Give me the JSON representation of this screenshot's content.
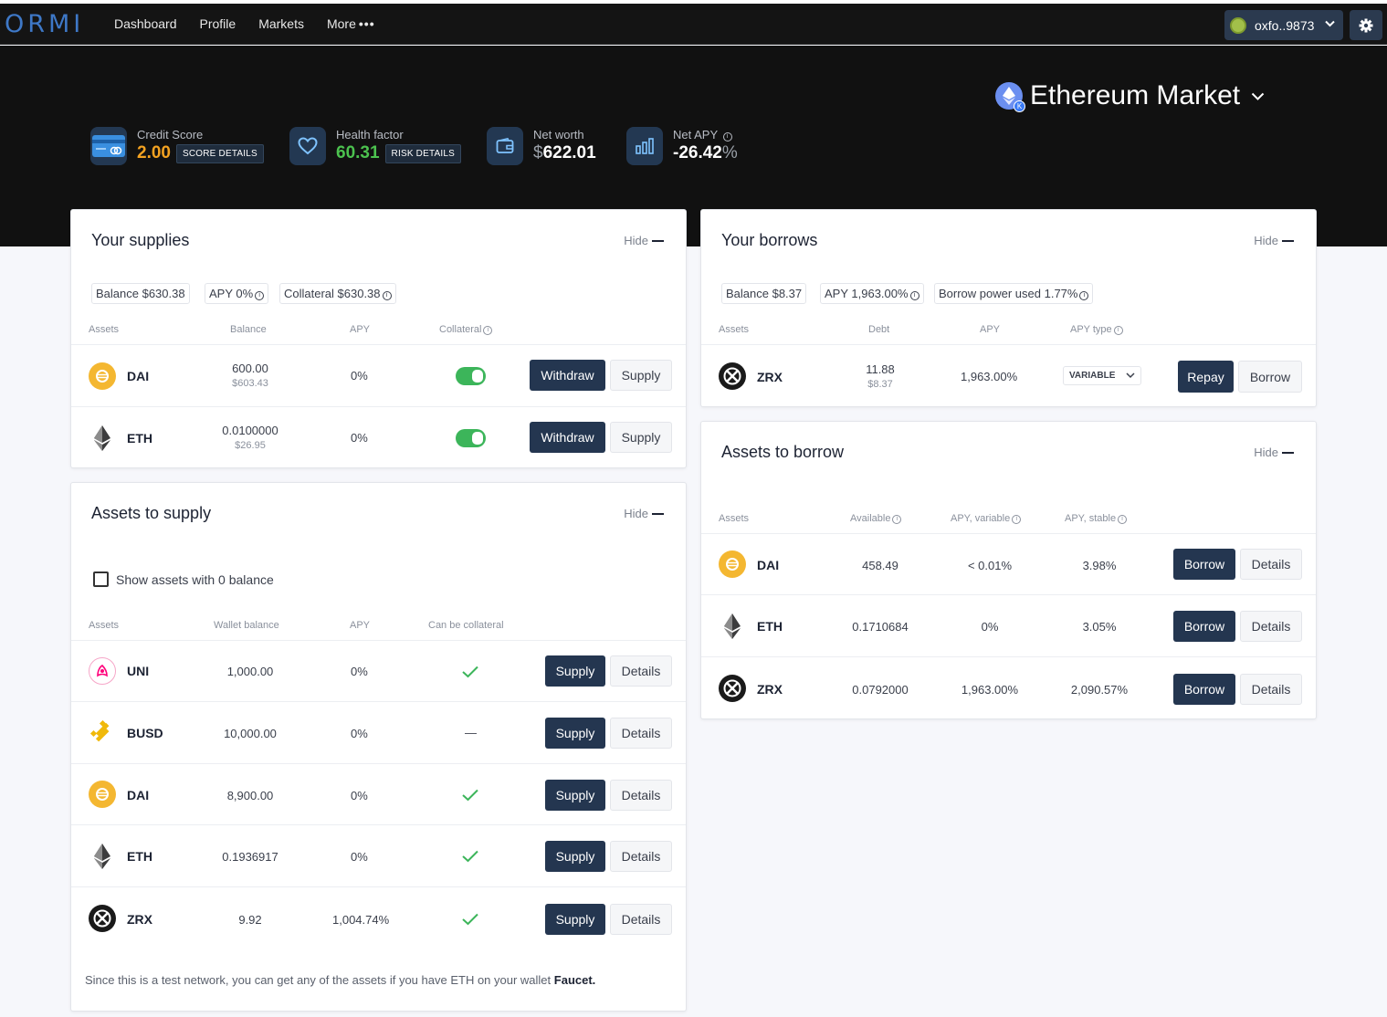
{
  "nav": {
    "logo": "ORMI",
    "links": [
      "Dashboard",
      "Profile",
      "Markets",
      "More"
    ],
    "wallet": "oxfo..9873"
  },
  "hero": {
    "market_title": "Ethereum Market",
    "credit_score": {
      "label": "Credit Score",
      "value": "2.00",
      "button": "SCORE DETAILS"
    },
    "health_factor": {
      "label": "Health factor",
      "value": "60.31",
      "button": "RISK DETAILS"
    },
    "net_worth": {
      "label": "Net worth",
      "currency": "$",
      "value": "622.01"
    },
    "net_apy": {
      "label": "Net APY",
      "value": "-26.42",
      "unit": "%"
    }
  },
  "supplies": {
    "title": "Your supplies",
    "hide": "Hide",
    "chips": {
      "balance": "Balance $630.38",
      "apy": "APY 0%",
      "collateral": "Collateral $630.38"
    },
    "headers": {
      "assets": "Assets",
      "balance": "Balance",
      "apy": "APY",
      "collateral": "Collateral"
    },
    "rows": [
      {
        "asset": "DAI",
        "balance": "600.00",
        "usd": "$603.43",
        "apy": "0%",
        "withdraw": "Withdraw",
        "supply": "Supply"
      },
      {
        "asset": "ETH",
        "balance": "0.0100000",
        "usd": "$26.95",
        "apy": "0%",
        "withdraw": "Withdraw",
        "supply": "Supply"
      }
    ]
  },
  "to_supply": {
    "title": "Assets to supply",
    "hide": "Hide",
    "show_zero": "Show assets with 0 balance",
    "headers": {
      "assets": "Assets",
      "wallet_balance": "Wallet balance",
      "apy": "APY",
      "collateral": "Can be collateral"
    },
    "rows": [
      {
        "asset": "UNI",
        "balance": "1,000.00",
        "apy": "0%",
        "collateral": "check",
        "supply": "Supply",
        "details": "Details"
      },
      {
        "asset": "BUSD",
        "balance": "10,000.00",
        "apy": "0%",
        "collateral": "—",
        "supply": "Supply",
        "details": "Details"
      },
      {
        "asset": "DAI",
        "balance": "8,900.00",
        "apy": "0%",
        "collateral": "check",
        "supply": "Supply",
        "details": "Details"
      },
      {
        "asset": "ETH",
        "balance": "0.1936917",
        "apy": "0%",
        "collateral": "check",
        "supply": "Supply",
        "details": "Details"
      },
      {
        "asset": "ZRX",
        "balance": "9.92",
        "apy": "1,004.74%",
        "collateral": "check",
        "supply": "Supply",
        "details": "Details"
      }
    ],
    "footnote": "Since this is a test network, you can get any of the assets if you have ETH on your wallet",
    "faucet": "Faucet."
  },
  "borrows": {
    "title": "Your borrows",
    "hide": "Hide",
    "chips": {
      "balance": "Balance $8.37",
      "apy": "APY 1,963.00%",
      "power": "Borrow power used 1.77%"
    },
    "headers": {
      "assets": "Assets",
      "debt": "Debt",
      "apy": "APY",
      "apy_type": "APY type"
    },
    "rows": [
      {
        "asset": "ZRX",
        "debt": "11.88",
        "usd": "$8.37",
        "apy": "1,963.00%",
        "type": "VARIABLE",
        "repay": "Repay",
        "borrow": "Borrow"
      }
    ]
  },
  "to_borrow": {
    "title": "Assets to borrow",
    "hide": "Hide",
    "headers": {
      "assets": "Assets",
      "available": "Available",
      "apy_variable": "APY, variable",
      "apy_stable": "APY, stable"
    },
    "rows": [
      {
        "asset": "DAI",
        "available": "458.49",
        "variable": "< 0.01%",
        "stable": "3.98%",
        "borrow": "Borrow",
        "details": "Details"
      },
      {
        "asset": "ETH",
        "available": "0.1710684",
        "variable": "0%",
        "stable": "3.05%",
        "borrow": "Borrow",
        "details": "Details"
      },
      {
        "asset": "ZRX",
        "available": "0.0792000",
        "variable": "1,963.00%",
        "stable": "2,090.57%",
        "borrow": "Borrow",
        "details": "Details"
      }
    ]
  },
  "colors": {
    "accent": "#243650",
    "header_bg": "#111111",
    "orange": "#f3a221",
    "green": "#4cc24f"
  }
}
